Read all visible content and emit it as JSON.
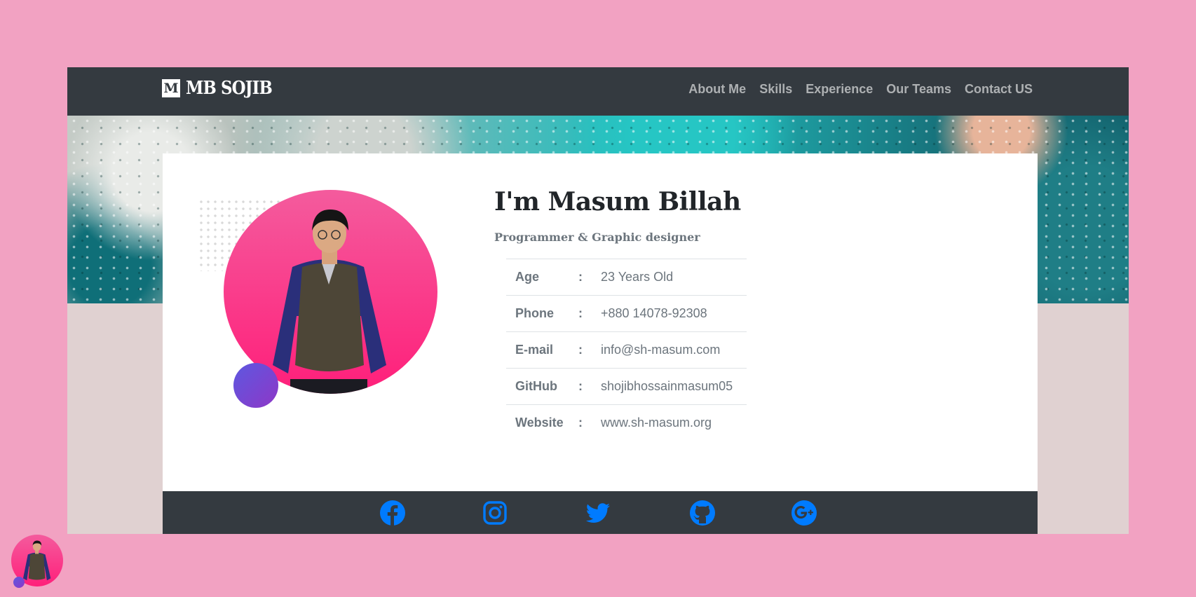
{
  "brand": {
    "mark": "M",
    "name": "MB SOJIB"
  },
  "nav": [
    {
      "label": "About Me"
    },
    {
      "label": "Skills"
    },
    {
      "label": "Experience"
    },
    {
      "label": "Our Teams"
    },
    {
      "label": "Contact US"
    }
  ],
  "profile": {
    "name": "I'm Masum Billah",
    "role": "Programmer & Graphic designer",
    "rows": [
      {
        "key": "Age",
        "sep": ":",
        "value": "23 Years Old"
      },
      {
        "key": "Phone",
        "sep": ":",
        "value": "+880 14078-92308"
      },
      {
        "key": "E-mail",
        "sep": ":",
        "value": "info@sh-masum.com"
      },
      {
        "key": "GitHub",
        "sep": ":",
        "value": "shojibhossainmasum05"
      },
      {
        "key": "Website",
        "sep": ":",
        "value": "www.sh-masum.org"
      }
    ]
  },
  "social": {
    "icons": [
      "facebook-icon",
      "instagram-icon",
      "twitter-icon",
      "github-icon",
      "google-plus-icon"
    ],
    "color": "#007bff"
  },
  "colors": {
    "background": "#f2a2c2",
    "navbar": "#343a40",
    "avatar_gradient": [
      "#f45b9d",
      "#ff1f7a"
    ],
    "accent_dot": [
      "#5d58e0",
      "#8e37c7"
    ]
  }
}
